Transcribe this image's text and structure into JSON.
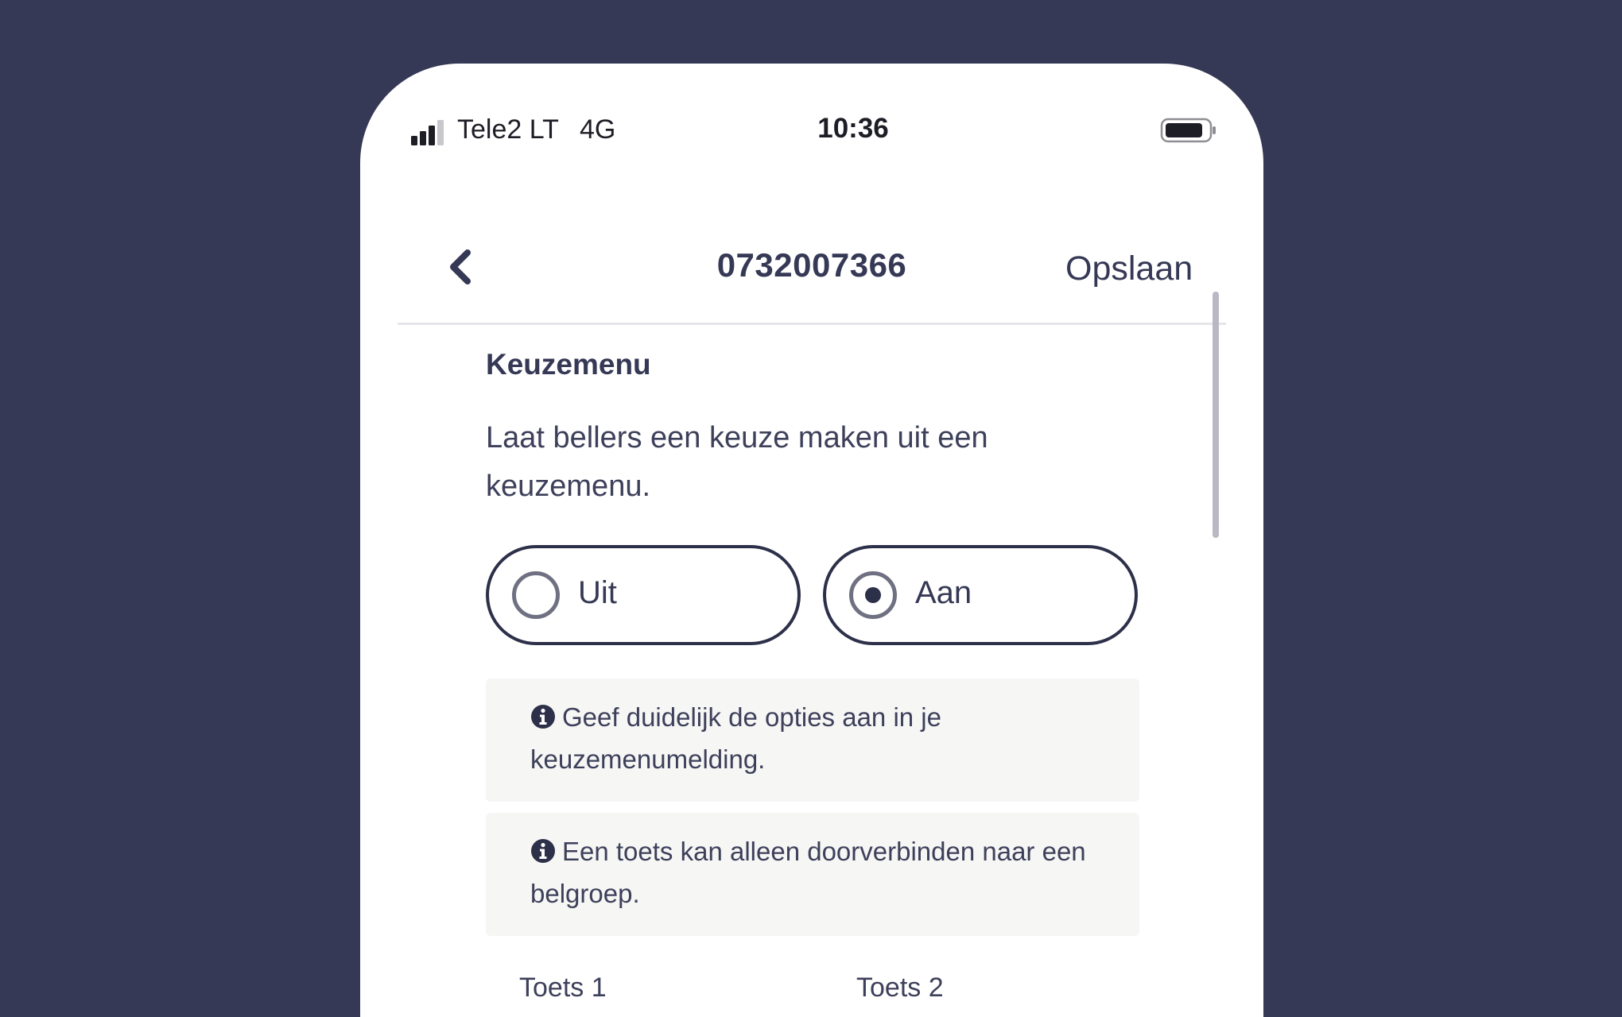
{
  "status_bar": {
    "carrier": "Tele2 LT",
    "network": "4G",
    "time": "10:36",
    "icons": [
      "signal-icon",
      "battery-icon"
    ]
  },
  "header": {
    "back_icon": "chevron-left-icon",
    "title": "0732007366",
    "save_label": "Opslaan"
  },
  "section": {
    "title": "Keuzemenu",
    "description": "Laat bellers een keuze maken uit een keuzemenu."
  },
  "options": [
    {
      "label": "Uit",
      "selected": false
    },
    {
      "label": "Aan",
      "selected": true
    }
  ],
  "info_boxes": [
    {
      "icon": "info-icon",
      "text": "Geef duidelijk de opties aan in je keuzemenumelding."
    },
    {
      "icon": "info-icon",
      "text": "Een toets kan alleen doorverbinden naar een belgroep."
    }
  ],
  "keys": [
    {
      "label": "Toets 1"
    },
    {
      "label": "Toets 2"
    }
  ],
  "colors": {
    "background": "#363955",
    "primary_text": "#363955",
    "border": "#2d3049",
    "info_background": "#f6f6f5"
  }
}
